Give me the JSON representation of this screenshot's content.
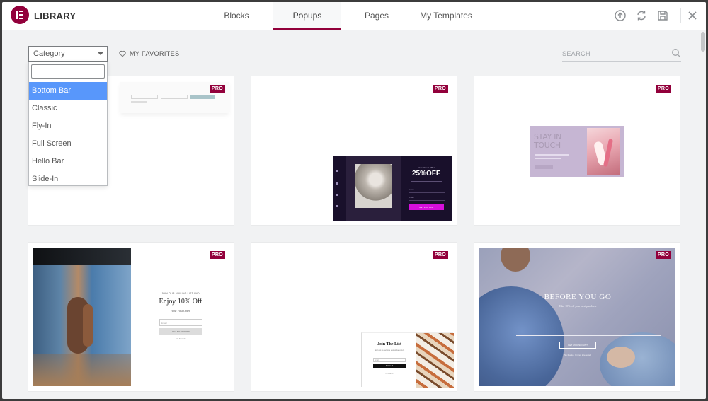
{
  "header": {
    "title": "LIBRARY",
    "tabs": [
      {
        "label": "Blocks"
      },
      {
        "label": "Popups"
      },
      {
        "label": "Pages"
      },
      {
        "label": "My Templates"
      }
    ],
    "icons": [
      "upload-icon",
      "sync-icon",
      "save-icon",
      "close-icon"
    ]
  },
  "toolbar": {
    "category": {
      "selected_label": "Category",
      "search_value": "",
      "options": [
        "Bottom Bar",
        "Classic",
        "Fly-In",
        "Full Screen",
        "Hello Bar",
        "Slide-In"
      ],
      "highlighted": "Bottom Bar"
    },
    "favorites_label": "MY FAVORITES",
    "search_placeholder": "SEARCH"
  },
  "badge_label": "PRO",
  "templates": [
    {
      "name": "bottom-bar-form",
      "badge": "PRO"
    },
    {
      "name": "25-off-dark",
      "badge": "PRO",
      "texts": {
        "eyebrow": "New Orders Offer",
        "headline": "25%OFF",
        "field_1": "Name",
        "field_2": "Email",
        "cta": "GET 25% OFF"
      }
    },
    {
      "name": "stay-in-touch",
      "badge": "PRO",
      "texts": {
        "headline": "STAY IN TOUCH"
      }
    },
    {
      "name": "enjoy-10-off",
      "badge": "PRO",
      "texts": {
        "eyebrow": "JOIN OUR MAILING LIST AND",
        "headline": "Enjoy 10% Off",
        "sub": "Your First Order",
        "field": "Email",
        "cta": "GET MY 10% OFF",
        "dismiss": "No Thanks"
      }
    },
    {
      "name": "join-the-list",
      "badge": "PRO",
      "texts": {
        "headline": "Join The List",
        "sub": "Sign up to receive exclusive offers",
        "field": "Email",
        "cta": "SIGN UP",
        "dismiss": "no thanks"
      }
    },
    {
      "name": "before-you-go",
      "badge": "PRO",
      "texts": {
        "headline": "BEFORE YOU GO",
        "sub": "Take 10% off your next purchase",
        "cta": "GET MY DISCOUNT",
        "dismiss": "No thanks. I'm not interested"
      }
    }
  ],
  "colors": {
    "accent": "#92003b",
    "select_highlight": "#5897fb",
    "background": "#f1f2f3"
  }
}
